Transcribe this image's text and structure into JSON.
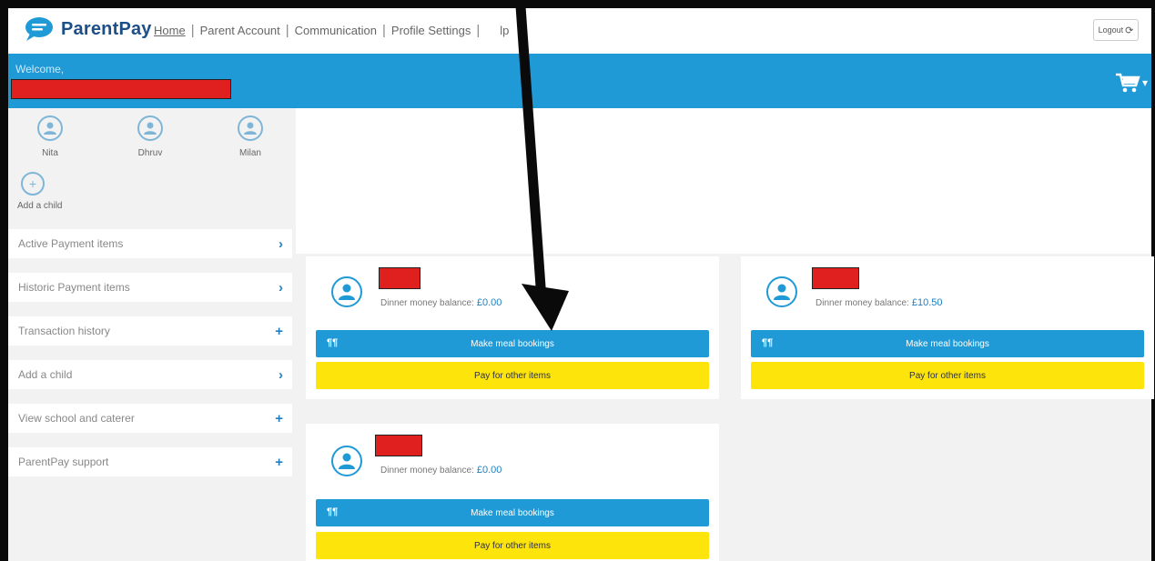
{
  "header": {
    "brand": "ParentPay",
    "nav": [
      {
        "label": "Home"
      },
      {
        "label": "Parent Account"
      },
      {
        "label": "Communication"
      },
      {
        "label": "Profile Settings"
      },
      {
        "label": "lp"
      }
    ],
    "logout_label": "Logout"
  },
  "welcome": {
    "text": "Welcome,"
  },
  "children": [
    {
      "name": "Nita"
    },
    {
      "name": "Dhruv"
    },
    {
      "name": "Milan"
    }
  ],
  "add_child_label": "Add a child",
  "menu": [
    {
      "label": "Active Payment items",
      "icon": "›"
    },
    {
      "label": "Historic Payment items",
      "icon": "›"
    },
    {
      "label": "Transaction history",
      "icon": "+"
    },
    {
      "label": "Add a child",
      "icon": "›"
    },
    {
      "label": "View school and caterer",
      "icon": "+"
    },
    {
      "label": "ParentPay support",
      "icon": "+"
    }
  ],
  "cards": [
    {
      "balance_label": "Dinner money balance:",
      "balance": "£0.00",
      "meal_label": "Make meal bookings",
      "pay_label": "Pay for other items"
    },
    {
      "balance_label": "Dinner money balance:",
      "balance": "£10.50",
      "meal_label": "Make meal bookings",
      "pay_label": "Pay for other items"
    },
    {
      "balance_label": "Dinner money balance:",
      "balance": "£0.00",
      "meal_label": "Make meal bookings",
      "pay_label": "Pay for other items"
    }
  ],
  "colors": {
    "primary": "#1f9ad6",
    "brand": "#1d4f87",
    "pay_button": "#fde40a",
    "redaction": "#e0201e"
  }
}
